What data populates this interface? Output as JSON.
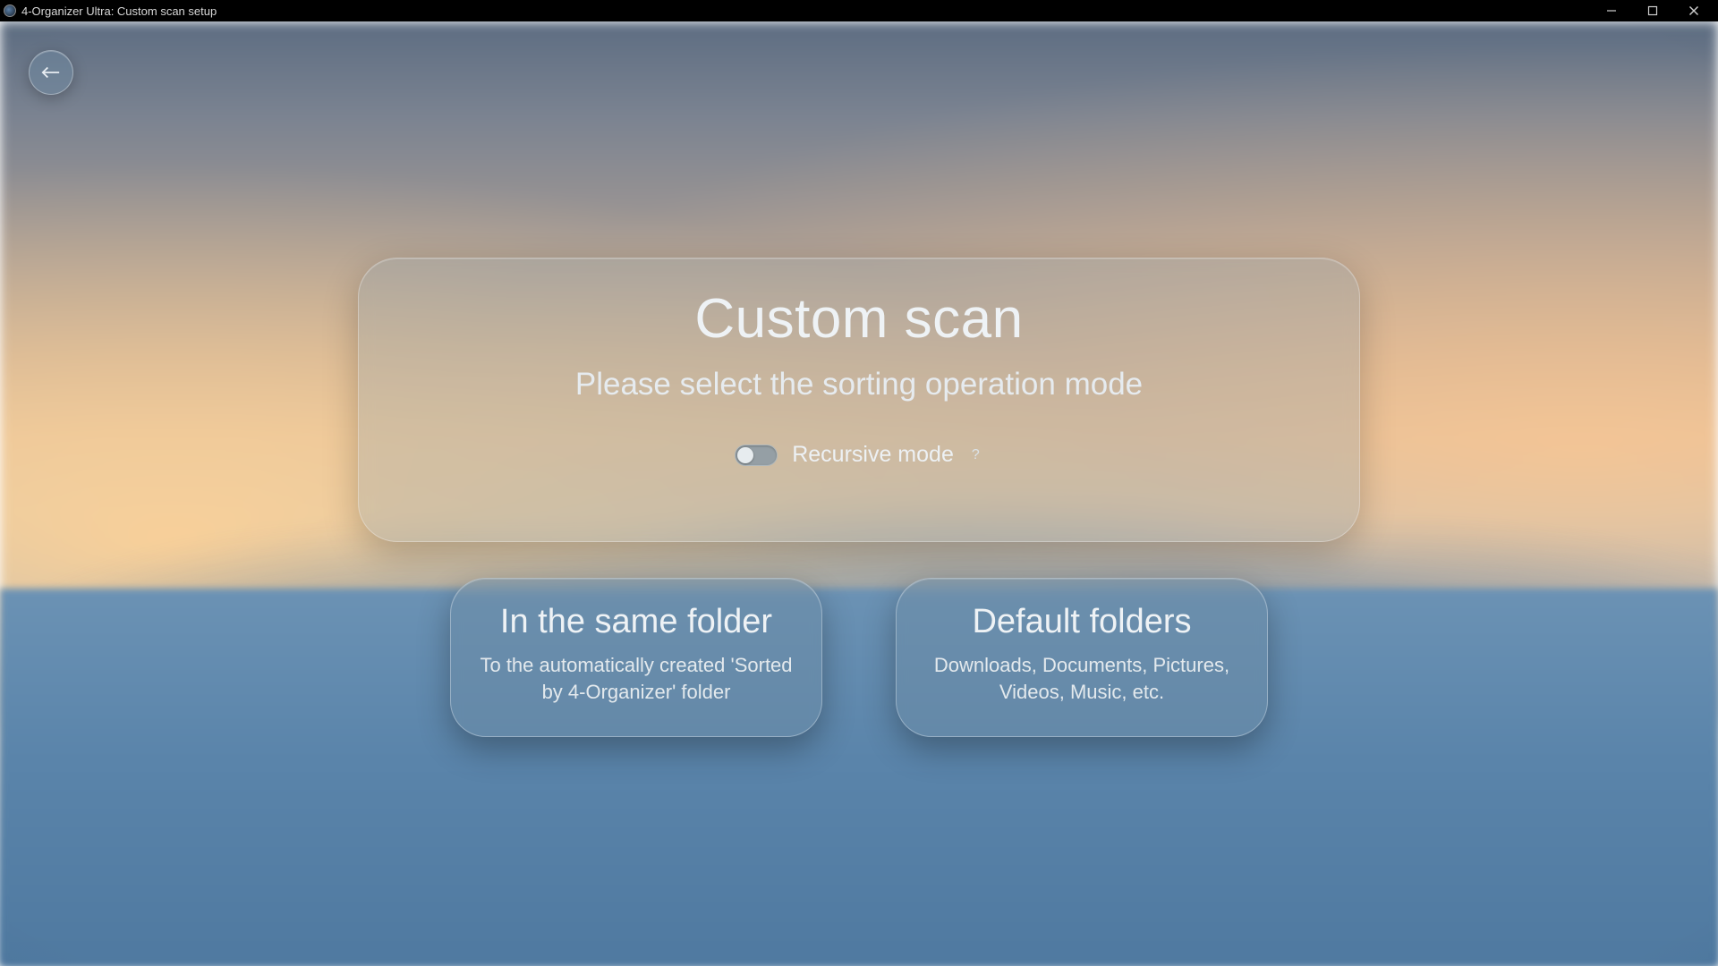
{
  "window": {
    "title": "4-Organizer Ultra: Custom scan setup"
  },
  "main": {
    "title": "Custom scan",
    "subtitle": "Please select the sorting operation mode",
    "toggle": {
      "label": "Recursive mode",
      "help": "?",
      "checked": false
    }
  },
  "options": [
    {
      "title": "In the same folder",
      "desc": "To the automatically created 'Sorted by 4-Organizer' folder"
    },
    {
      "title": "Default folders",
      "desc": "Downloads, Documents, Pictures, Videos, Music, etc."
    }
  ]
}
